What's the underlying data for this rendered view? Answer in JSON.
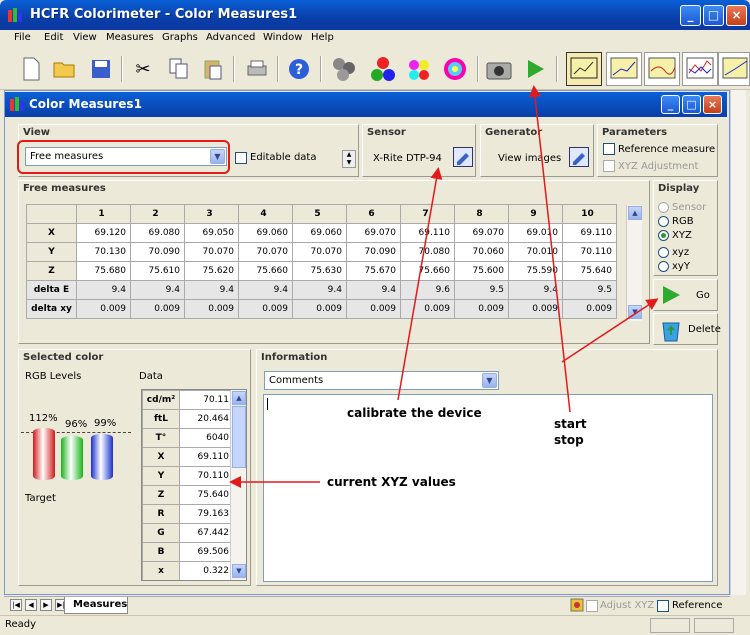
{
  "app": {
    "title": "HCFR Colorimeter - Color Measures1"
  },
  "menu": [
    "File",
    "Edit",
    "View",
    "Measures",
    "Graphs",
    "Advanced",
    "Window",
    "Help"
  ],
  "toolbar": {
    "icons": [
      "new-icon",
      "open-icon",
      "save-icon",
      "cut-icon",
      "copy-icon",
      "paste-icon",
      "print-icon",
      "help-icon",
      "sensor-balls-icon",
      "rgb-icon",
      "color-patches-icon",
      "color-wheel-icon",
      "camera-icon",
      "play-icon",
      "chart-screen-icon",
      "chart-line1-icon",
      "chart-line2-icon",
      "chart-multi-icon",
      "chart-line3-icon"
    ]
  },
  "child": {
    "title": "Color Measures1"
  },
  "view_panel": {
    "title": "View",
    "combo_value": "Free measures",
    "editable_label": "Editable data"
  },
  "sensor_panel": {
    "title": "Sensor",
    "button": "X-Rite DTP-94"
  },
  "generator_panel": {
    "title": "Generator",
    "button": "View images"
  },
  "parameters_panel": {
    "title": "Parameters",
    "ref_label": "Reference measure",
    "xyz_adj_label": "XYZ Adjustment"
  },
  "measures": {
    "title": "Free measures",
    "columns": [
      "1",
      "2",
      "3",
      "4",
      "5",
      "6",
      "7",
      "8",
      "9",
      "10"
    ],
    "rows": [
      {
        "label": "X",
        "values": [
          "69.120",
          "69.080",
          "69.050",
          "69.060",
          "69.060",
          "69.070",
          "69.110",
          "69.070",
          "69.010",
          "69.110"
        ]
      },
      {
        "label": "Y",
        "values": [
          "70.130",
          "70.090",
          "70.070",
          "70.070",
          "70.070",
          "70.090",
          "70.080",
          "70.060",
          "70.010",
          "70.110"
        ]
      },
      {
        "label": "Z",
        "values": [
          "75.680",
          "75.610",
          "75.620",
          "75.660",
          "75.630",
          "75.670",
          "75.660",
          "75.600",
          "75.590",
          "75.640"
        ]
      },
      {
        "label": "delta E",
        "values": [
          "9.4",
          "9.4",
          "9.4",
          "9.4",
          "9.4",
          "9.4",
          "9.6",
          "9.5",
          "9.4",
          "9.5"
        ]
      },
      {
        "label": "delta xy",
        "values": [
          "0.009",
          "0.009",
          "0.009",
          "0.009",
          "0.009",
          "0.009",
          "0.009",
          "0.009",
          "0.009",
          "0.009"
        ]
      }
    ]
  },
  "display_panel": {
    "title": "Display",
    "options": [
      "Sensor",
      "RGB",
      "XYZ",
      "xyz",
      "xyY"
    ],
    "selected": "XYZ"
  },
  "go_button": "Go",
  "delete_button": "Delete",
  "selected_color": {
    "title": "Selected color",
    "rgb_label": "RGB Levels",
    "data_label": "Data",
    "target_label": "Target",
    "bars": [
      {
        "pct": "112%",
        "level": 1.12,
        "color": "#d11a1a"
      },
      {
        "pct": "96%",
        "level": 0.96,
        "color": "#18b418"
      },
      {
        "pct": "99%",
        "level": 0.99,
        "color": "#1a2fcf"
      }
    ],
    "data_rows": [
      {
        "k": "cd/m²",
        "v": "70.11"
      },
      {
        "k": "ftL",
        "v": "20.464"
      },
      {
        "k": "T°",
        "v": "6040"
      },
      {
        "k": "X",
        "v": "69.110"
      },
      {
        "k": "Y",
        "v": "70.110"
      },
      {
        "k": "Z",
        "v": "75.640"
      },
      {
        "k": "R",
        "v": "79.163"
      },
      {
        "k": "G",
        "v": "67.442"
      },
      {
        "k": "B",
        "v": "69.506"
      },
      {
        "k": "x",
        "v": "0.322"
      }
    ]
  },
  "information": {
    "title": "Information",
    "combo_value": "Comments"
  },
  "annotations": {
    "calibrate": "calibrate the device",
    "start": "start",
    "stop": "stop",
    "xyz": "current XYZ values"
  },
  "tabs": {
    "active": "Measures",
    "adjust_label": "Adjust XYZ",
    "reference_label": "Reference"
  },
  "status": {
    "text": "Ready"
  }
}
